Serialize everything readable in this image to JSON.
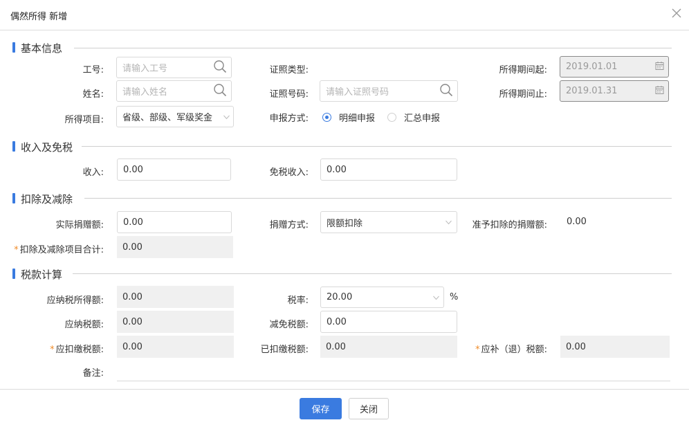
{
  "dialog": {
    "title": "偶然所得 新增"
  },
  "sections": {
    "basic": "基本信息",
    "income": "收入及免税",
    "deduction": "扣除及减除",
    "tax": "税款计算"
  },
  "basic": {
    "emp_no": {
      "label": "工号:",
      "placeholder": "请输入工号",
      "icon": "search-icon"
    },
    "name": {
      "label": "姓名:",
      "placeholder": "请输入姓名",
      "icon": "search-icon"
    },
    "income_item": {
      "label": "所得项目:",
      "value": "省级、部级、军级奖金",
      "icon": "chevron-down-icon"
    },
    "id_type": {
      "label": "证照类型:"
    },
    "id_no": {
      "label": "证照号码:",
      "placeholder": "请输入证照号码",
      "icon": "search-icon"
    },
    "filing": {
      "label": "申报方式:",
      "options": [
        "明细申报",
        "汇总申报"
      ],
      "selected": "明细申报"
    },
    "period_start": {
      "label": "所得期间起:",
      "value": "2019.01.01",
      "icon": "calendar-icon"
    },
    "period_end": {
      "label": "所得期间止:",
      "value": "2019.01.31",
      "icon": "calendar-icon"
    }
  },
  "income": {
    "income": {
      "label": "收入:",
      "value": "0.00"
    },
    "exempt": {
      "label": "免税收入:",
      "value": "0.00"
    }
  },
  "deduction": {
    "donation": {
      "label": "实际捐赠额:",
      "value": "0.00"
    },
    "method": {
      "label": "捐赠方式:",
      "value": "限额扣除",
      "icon": "chevron-down-icon"
    },
    "allowed": {
      "label": "准予扣除的捐赠额:",
      "value": "0.00"
    },
    "total": {
      "label": "扣除及减除项目合计:",
      "value": "0.00",
      "required": "*"
    }
  },
  "tax": {
    "taxable_income": {
      "label": "应纳税所得额:",
      "value": "0.00"
    },
    "rate": {
      "label": "税率:",
      "value": "20.00",
      "unit": "%",
      "icon": "chevron-down-icon"
    },
    "tax_payable": {
      "label": "应纳税额:",
      "value": "0.00"
    },
    "reduction": {
      "label": "减免税额:",
      "value": "0.00"
    },
    "withholding": {
      "label": "应扣缴税额:",
      "value": "0.00",
      "required": "*"
    },
    "withheld": {
      "label": "已扣缴税额:",
      "value": "0.00"
    },
    "refund": {
      "label": "应补（退）税额:",
      "value": "0.00",
      "required": "*"
    },
    "remark": {
      "label": "备注:"
    }
  },
  "footer": {
    "save": "保存",
    "close": "关闭"
  },
  "colors": {
    "accent": "#3a7be0",
    "required": "#f08c2a",
    "readonly_bg": "#f0f0f0"
  }
}
